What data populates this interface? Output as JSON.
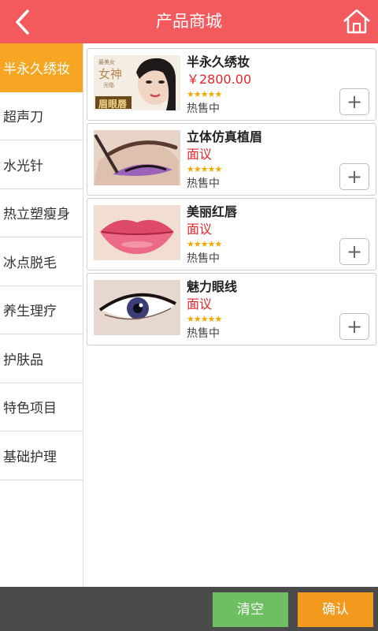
{
  "header": {
    "title": "产品商城",
    "back_icon": "chevron-left-icon",
    "home_icon": "home-icon",
    "bg_color": "#f35a5d"
  },
  "sidebar": {
    "items": [
      {
        "label": "半永久绣妆",
        "active": true
      },
      {
        "label": "超声刀",
        "active": false
      },
      {
        "label": "水光针",
        "active": false
      },
      {
        "label": "热立塑瘦身",
        "active": false
      },
      {
        "label": "冰点脱毛",
        "active": false
      },
      {
        "label": "养生理疗",
        "active": false
      },
      {
        "label": "护肤品",
        "active": false
      },
      {
        "label": "特色项目",
        "active": false
      },
      {
        "label": "基础护理",
        "active": false
      }
    ],
    "active_color": "#f7a623"
  },
  "thumb_texts": {
    "tag_small": "最美女",
    "tag_main": "女神",
    "tag_sub": "光临",
    "banner": "眉眼唇"
  },
  "products": [
    {
      "name": "半永久绣妆",
      "price": "￥2800.00",
      "rating": 5,
      "status": "热售中"
    },
    {
      "name": "立体仿真植眉",
      "price": "面议",
      "rating": 5,
      "status": "热售中"
    },
    {
      "name": "美丽红唇",
      "price": "面议",
      "rating": 5,
      "status": "热售中"
    },
    {
      "name": "魅力眼线",
      "price": "面议",
      "rating": 5,
      "status": "热售中"
    }
  ],
  "add_label": "+",
  "footer": {
    "clear_label": "清空",
    "confirm_label": "确认",
    "clear_color": "#6ebf62",
    "confirm_color": "#f39a1e"
  }
}
